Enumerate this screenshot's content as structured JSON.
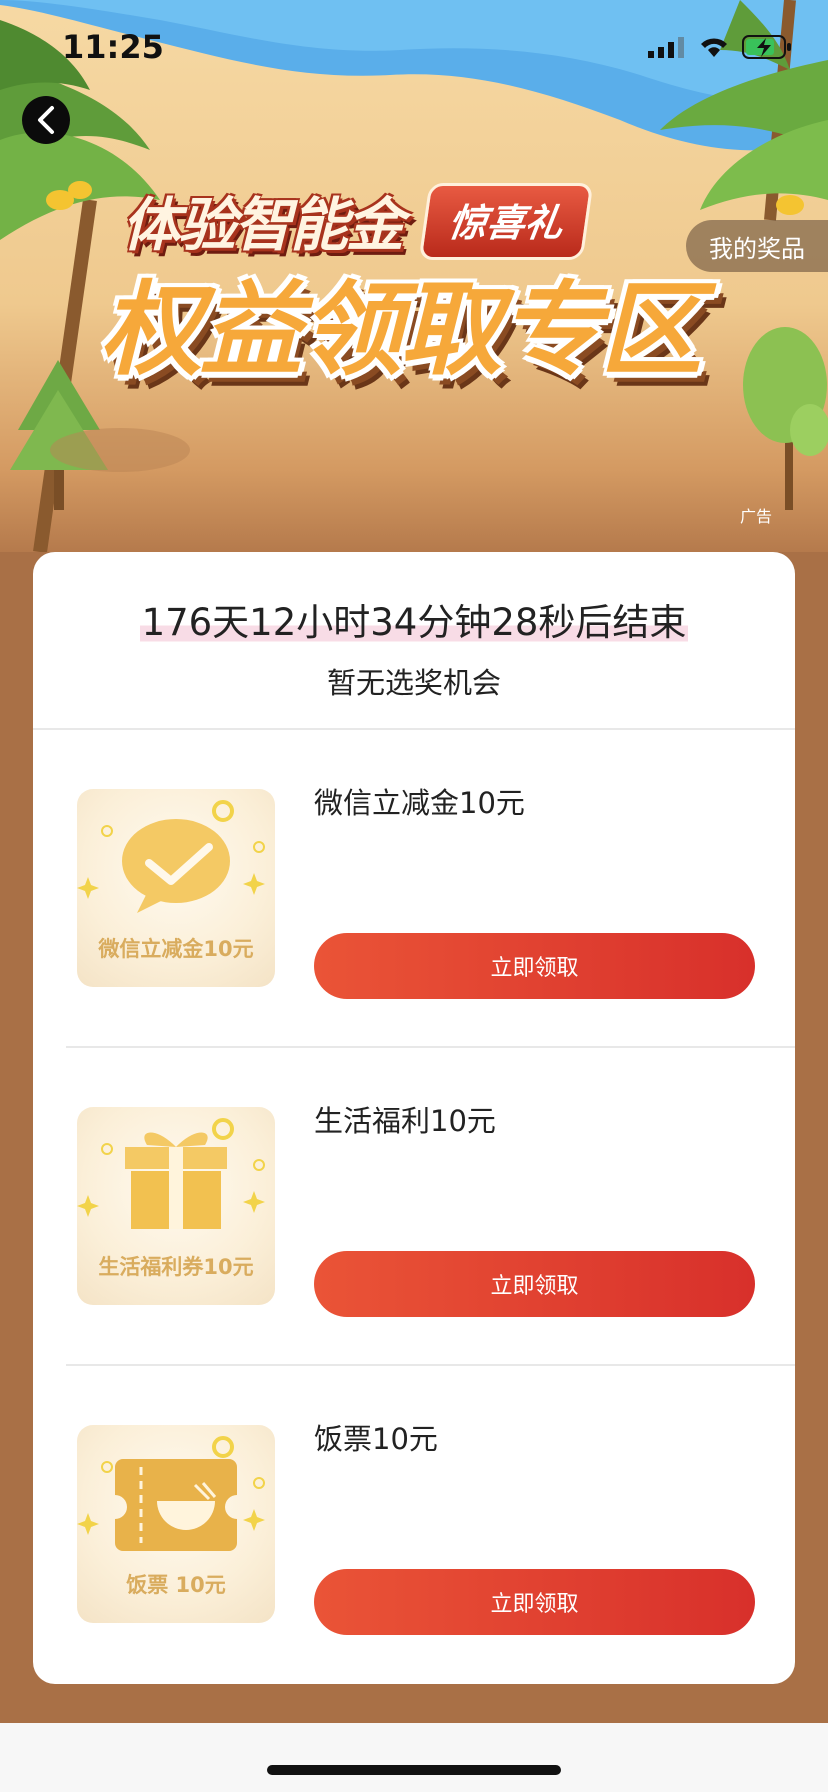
{
  "status_bar": {
    "time": "11:25",
    "icons": [
      "signal-icon",
      "wifi-icon",
      "battery-charging-icon"
    ]
  },
  "banner": {
    "title_line1": "体验智能金",
    "badge": "惊喜礼",
    "title_line2": "权益领取专区",
    "my_prizes": "我的奖品",
    "ad_label": "广告"
  },
  "activity": {
    "countdown": "176天12小时34分钟28秒后结束",
    "status": "暂无选奖机会"
  },
  "rewards": [
    {
      "title": "微信立减金10元",
      "image_caption": "微信立减金10元",
      "icon": "wechat-icon",
      "button": "立即领取"
    },
    {
      "title": "生活福利10元",
      "image_caption": "生活福利券10元",
      "icon": "gift-icon",
      "button": "立即领取"
    },
    {
      "title": "饭票10元",
      "image_caption": "饭票 10元",
      "icon": "meal-ticket-icon",
      "button": "立即领取"
    }
  ],
  "colors": {
    "page_background": "#a97046",
    "button_red": "#e0402f",
    "thumb_gold": "#f2c86a"
  }
}
